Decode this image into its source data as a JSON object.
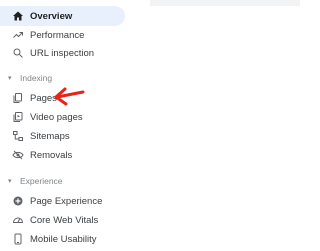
{
  "nav": {
    "overview": "Overview",
    "performance": "Performance",
    "url_inspection": "URL inspection",
    "indexing_header": "Indexing",
    "pages": "Pages",
    "video_pages": "Video pages",
    "sitemaps": "Sitemaps",
    "removals": "Removals",
    "experience_header": "Experience",
    "page_experience": "Page Experience",
    "core_web_vitals": "Core Web Vitals",
    "mobile_usability": "Mobile Usability"
  },
  "colors": {
    "active_bg": "#e8f0fe",
    "annotation_arrow": "#e8231a",
    "icon": "#5f6368"
  },
  "icons": {
    "overview": "home-icon",
    "performance": "trending-up-icon",
    "url_inspection": "search-icon",
    "pages": "pages-icon",
    "video_pages": "video-pages-icon",
    "sitemaps": "sitemap-icon",
    "removals": "removals-icon",
    "page_experience": "page-experience-icon",
    "core_web_vitals": "gauge-icon",
    "mobile_usability": "phone-icon"
  }
}
